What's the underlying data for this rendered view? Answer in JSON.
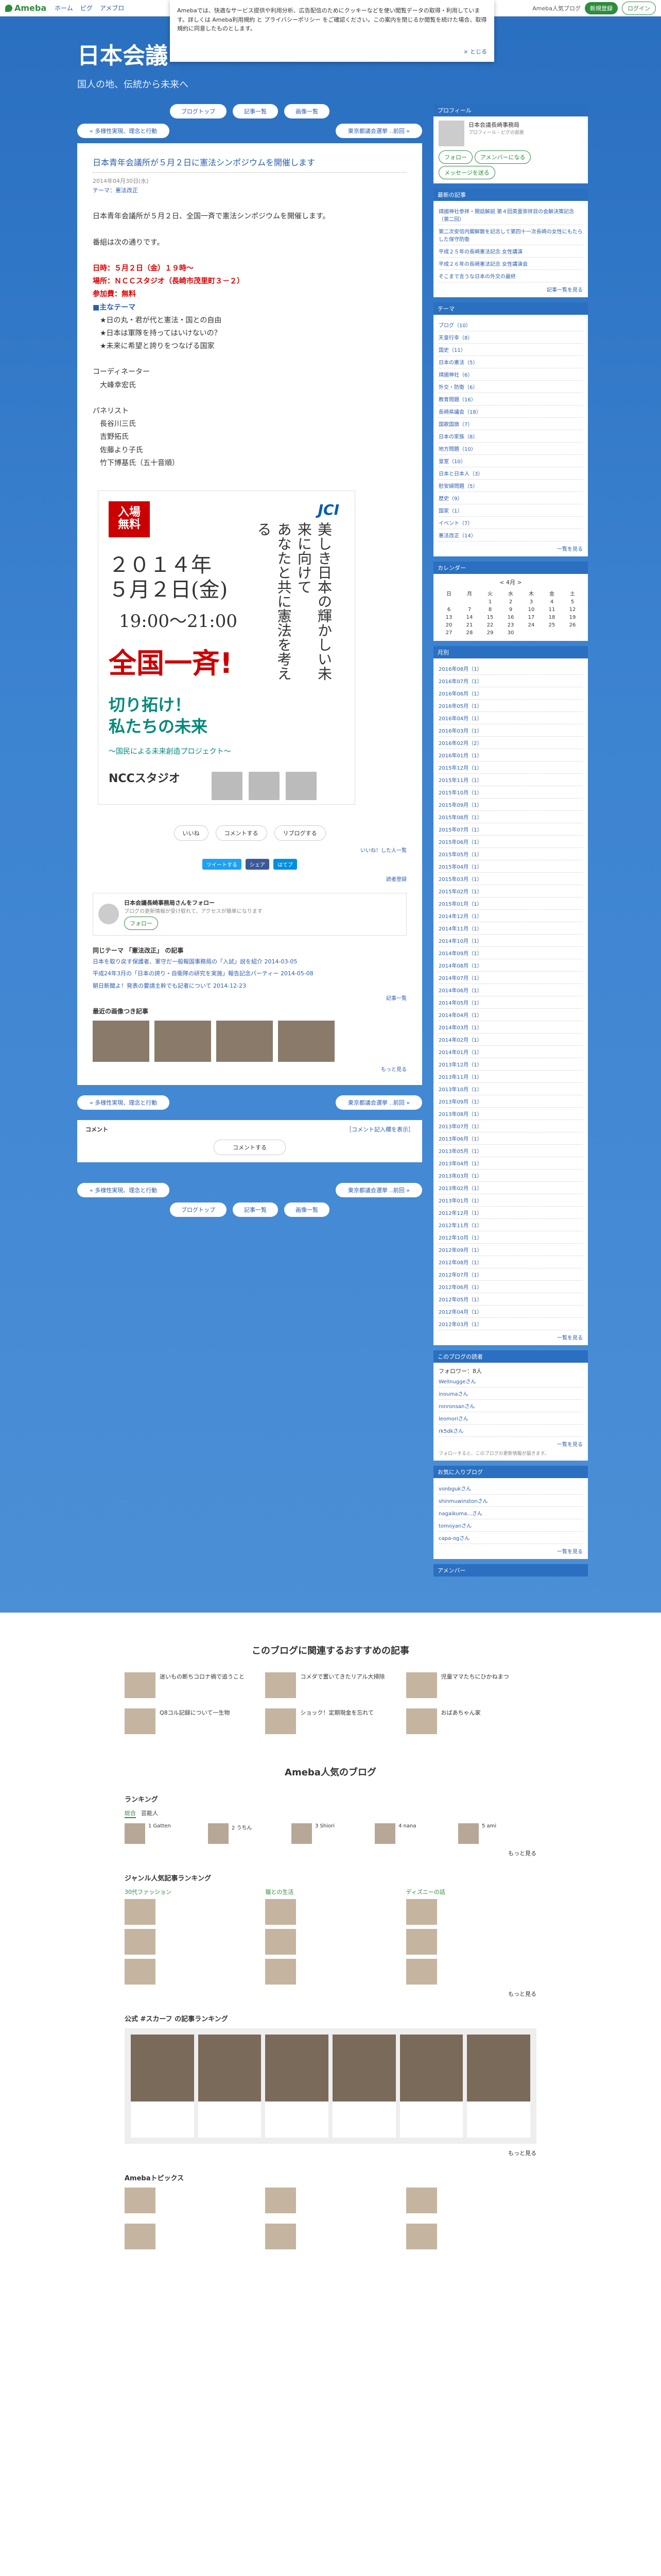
{
  "topbar": {
    "logo": "Ameba",
    "nav": [
      "ホーム",
      "ピグ",
      "アメブロ"
    ],
    "right_link": "Ameba人気ブログ",
    "signup": "新規登録",
    "login": "ログイン"
  },
  "cookie": {
    "text": "Amebaでは、快適なサービス提供や利用分析、広告配信のためにクッキーなどを使い閲覧データの取得・利用しています。詳しくは Ameba利用規約 と プライバシーポリシー をご確認ください。この案内を閉じるか閲覧を続けた場合、取得規約に同意したものとします。",
    "close": "× とじる"
  },
  "blog": {
    "title": "日本会議",
    "desc": "国人の地、伝統から未来へ"
  },
  "nav": {
    "prev": "« 多様性実現、理念と行動",
    "next": "東京都議会選挙 ‥前回 »",
    "bookmark": "ブログトップ",
    "entry_list": "記事一覧",
    "image_list": "画像一覧"
  },
  "entry": {
    "title": "日本青年会議所が５月２日に憲法シンポジウムを開催します",
    "date": "2014年04月30日(水)",
    "theme": "テーマ：憲法改正",
    "lines": [
      "日本青年会議所が５月２日、全国一斉で憲法シンポジウムを開催します。",
      "",
      "番組は次の通りです。",
      ""
    ],
    "red1": "日時：５月２日（金）１９時～",
    "red2": "場所：ＮＣＣスタジオ（長崎市茂里町３－２）",
    "red3": "参加費：無料",
    "blue": "■主なテーマ",
    "topics": [
      "　★日の丸・君が代と憲法・国との自由",
      "　★日本は軍隊を持ってはいけないの？",
      "　★未来に希望と誇りをつなげる国家"
    ],
    "coord_label": "コーディネーター",
    "coord": "　大峰幸宏氏",
    "panel_label": "パネリスト",
    "panel": [
      "　長谷川三氏",
      "　吉野拓氏",
      "　佐藤より子氏",
      "　竹下博基氏（五十音順）"
    ]
  },
  "flyer": {
    "badge": "入場\n無料",
    "jci": "JCI",
    "date": "２０１４年\n５月２日(金)",
    "time": "19:00～21:00",
    "vertical": "美しき日本の輝かしい未来に向けて\nあなたと共に憲法を考える",
    "all": "全国一斉!",
    "cut": "切り拓け！\n私たちの未来",
    "sub": "～国民による未来創造プロジェクト～",
    "venue": "NCCスタジオ"
  },
  "reactions": [
    "いいね",
    "コメントする",
    "リブログする"
  ],
  "reaction_counts": "いいね！した人一覧",
  "social": [
    "ツイートする",
    "シェア",
    "はてブ"
  ],
  "reader": "読者登録",
  "followbox": {
    "name": "日本会議長崎事務局さんをフォロー",
    "sub": "ブログの更新情報が受け取れて、アクセスが簡単になります",
    "btn": "フォロー"
  },
  "related": {
    "head": "同じテーマ 「憲法改正」 の記事",
    "items": [
      "日本を取り戻す保護者、軍守だ一般報国事務局の「入試」説を紹介 2014-03-05",
      "平成24年3月の「日本の誇り・自衛隊の研究を実施」報告記念パーティー 2014-05-08",
      "朝日新聞よ！発表の要請主幹でも記者について 2014-12-23"
    ],
    "more": "記事一覧",
    "photos_head": "最近の画像つき記事",
    "photos_more": "もっと見る"
  },
  "comment": {
    "title": "コメント",
    "note": "［コメント記入欄を表示］",
    "button": "コメントする"
  },
  "side": {
    "profile": {
      "h": "プロフィール",
      "name": "日本会議長崎事務局",
      "sub": "プロフィール・ピグの部屋",
      "follow": "フォロー",
      "ameba": "アメンバーになる",
      "message": "メッセージを送る"
    },
    "recent": {
      "h": "最新の記事",
      "items": [
        "靖國神社参拝・開話解説 第４回英霊崇拝目の会解決策記念（第二回）",
        "第二次安倍内閣解散を記念して第四十一次長崎の女性にもたらした保守防衛",
        "平成２５年の長崎憲法記念 女性講演",
        "平成２６年の長崎憲法記念 女性講演会",
        "そこまで言うな日本の外交の最終"
      ],
      "more": "記事一覧を見る"
    },
    "theme": {
      "h": "テーマ",
      "items": [
        "ブログ（10）",
        "天皇行幸（8）",
        "国史（11）",
        "日本の憲法（5）",
        "靖國神社（6）",
        "外交・防衛（6）",
        "教育問題（16）",
        "長崎県議会（18）",
        "国歌国旗（7）",
        "日本の家族（8）",
        "地方問題（10）",
        "皇室（10）",
        "日本と日本人（3）",
        "慰安婦問題（5）",
        "歴史（9）",
        "国家（1）",
        "イベント（7）",
        "憲法改正（14）"
      ],
      "more": "一覧を見る"
    },
    "calendar": {
      "h": "カレンダー",
      "month": "< 4月 >",
      "days": [
        "日",
        "月",
        "火",
        "水",
        "木",
        "金",
        "土"
      ],
      "weeks": [
        [
          "",
          "",
          "1",
          "2",
          "3",
          "4",
          "5"
        ],
        [
          "6",
          "7",
          "8",
          "9",
          "10",
          "11",
          "12"
        ],
        [
          "13",
          "14",
          "15",
          "16",
          "17",
          "18",
          "19"
        ],
        [
          "20",
          "21",
          "22",
          "23",
          "24",
          "25",
          "26"
        ],
        [
          "27",
          "28",
          "29",
          "30",
          "",
          "",
          ""
        ]
      ]
    },
    "archive": {
      "h": "月別",
      "items": [
        "2016年08月（1）",
        "2016年07月（1）",
        "2016年06月（1）",
        "2016年05月（1）",
        "2016年04月（1）",
        "2016年03月（1）",
        "2016年02月（2）",
        "2016年01月（1）",
        "2015年12月（1）",
        "2015年11月（1）",
        "2015年10月（1）",
        "2015年09月（1）",
        "2015年08月（1）",
        "2015年07月（1）",
        "2015年06月（1）",
        "2015年05月（1）",
        "2015年04月（1）",
        "2015年03月（1）",
        "2015年02月（1）",
        "2015年01月（1）",
        "2014年12月（1）",
        "2014年11月（1）",
        "2014年10月（1）",
        "2014年09月（1）",
        "2014年08月（1）",
        "2014年07月（1）",
        "2014年06月（1）",
        "2014年05月（1）",
        "2014年04月（1）",
        "2014年03月（1）",
        "2014年02月（1）",
        "2014年01月（1）",
        "2013年12月（1）",
        "2013年11月（1）",
        "2013年10月（1）",
        "2013年09月（1）",
        "2013年08月（1）",
        "2013年07月（1）",
        "2013年06月（1）",
        "2013年05月（1）",
        "2013年04月（1）",
        "2013年03月（1）",
        "2013年02月（1）",
        "2013年01月（1）",
        "2012年12月（1）",
        "2012年11月（1）",
        "2012年10月（1）",
        "2012年09月（1）",
        "2012年08月（1）",
        "2012年07月（1）",
        "2012年06月（1）",
        "2012年05月（1）",
        "2012年04月（1）",
        "2012年03月（1）"
      ],
      "more": "一覧を見る"
    },
    "followers": {
      "h": "このブログの読者",
      "count": "フォロワー：8人",
      "items": [
        "Wellnuggeさん",
        "inoumaさん",
        "ronronsanさん",
        "leomoriさん",
        "rk5dkさん"
      ],
      "more": "一覧を見る",
      "note": "フォローすると、このブログの更新情報が届きます。"
    },
    "liked": {
      "h": "お気に入りブログ",
      "items": [
        "vonbgukさん",
        "shinmuwinstonさん",
        "nagaikuma...さん",
        "tomoyanさん",
        "capa-ogさん"
      ],
      "more": "一覧を見る"
    },
    "last_h": "アメンバー"
  },
  "recommend": {
    "title": "このブログに関連するおすすめの記事",
    "items": [
      "迷いもの断ちコロナ禍で追うこと",
      "コメダで置いてきたリアル大掃除",
      "児童ママたちにひかねまつ",
      "Q8コル記録について一生物",
      "ショック！定期現金を忘れて",
      "おばあちゃん家"
    ]
  },
  "popular": {
    "title": "Ameba人気のブログ",
    "ranking": "ランキング",
    "tabs": [
      "総合",
      "芸能人"
    ],
    "ranks": [
      "1 Gatten",
      "2 うちん",
      "3 Shiori",
      "4 nana",
      "5 ami"
    ],
    "genre": "ジャンル人気記事ランキング",
    "genre_cols": [
      "30代ファッション",
      "猫との生活",
      "ディズニーの話"
    ],
    "official": "公式 #スカーフ の記事ランキング",
    "topics": "Amebaトピックス",
    "more": "もっと見る"
  }
}
